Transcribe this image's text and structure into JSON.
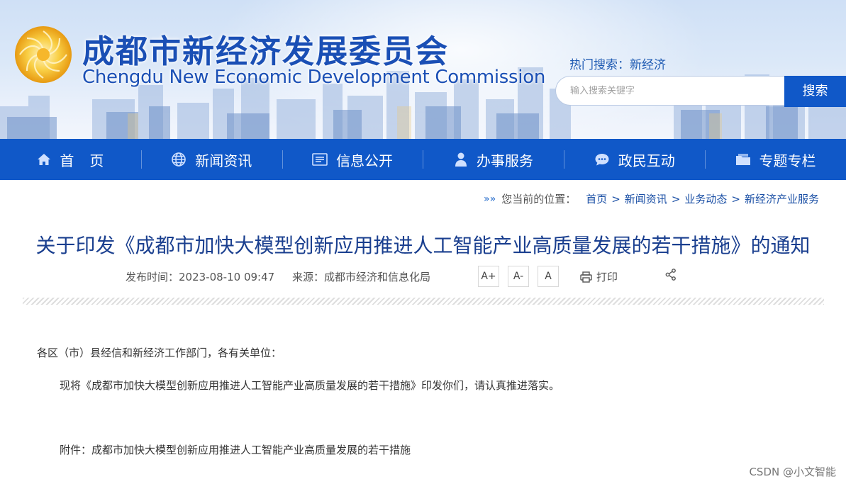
{
  "header": {
    "title_cn": "成都市新经济发展委员会",
    "title_en": "Chengdu New Economic Development Commission",
    "hot_search": "热门搜索：新经济",
    "search_placeholder": "输入搜索关键字",
    "search_button": "搜索"
  },
  "nav": {
    "items": [
      {
        "label": "首页",
        "icon": "home-icon"
      },
      {
        "label": "新闻资讯",
        "icon": "globe-icon"
      },
      {
        "label": "信息公开",
        "icon": "document-list-icon"
      },
      {
        "label": "办事服务",
        "icon": "person-icon"
      },
      {
        "label": "政民互动",
        "icon": "chat-bubble-icon"
      },
      {
        "label": "专题专栏",
        "icon": "folder-icon"
      }
    ]
  },
  "breadcrumb": {
    "prefix": "您当前的位置：",
    "items": [
      "首页",
      "新闻资讯",
      "业务动态",
      "新经济产业服务"
    ],
    "separator": ">"
  },
  "article": {
    "title": "关于印发《成都市加快大模型创新应用推进人工智能产业高质量发展的若干措施》的通知",
    "publish": "发布时间：2023-08-10 09:47",
    "source": "来源：成都市经济和信息化局",
    "font_buttons": [
      "A+",
      "A-",
      "A"
    ],
    "print_label": "打印",
    "paragraphs": [
      "各区（市）县经信和新经济工作部门，各有关单位：",
      "现将《成都市加快大模型创新应用推进人工智能产业高质量发展的若干措施》印发你们，请认真推进落实。",
      "附件：成都市加快大模型创新应用推进人工智能产业高质量发展的若干措施"
    ]
  },
  "watermark": "CSDN @小文智能",
  "colors": {
    "brand_blue": "#1058c8",
    "title_blue": "#1a3f8f",
    "link_blue": "#1a4fa5"
  }
}
